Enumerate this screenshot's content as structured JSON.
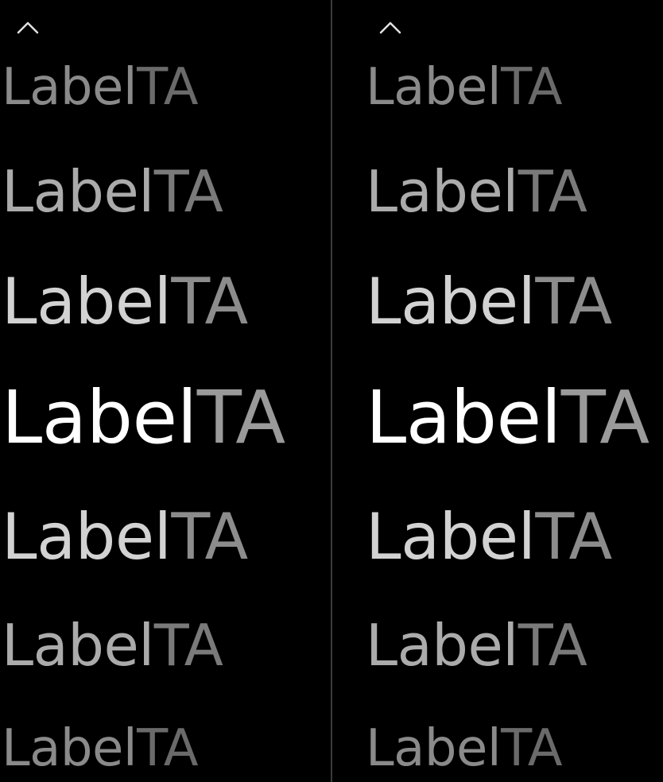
{
  "picker_left": {
    "scroll_up_icon": "chevron-up-icon",
    "items": [
      {
        "label": "Label",
        "suffix": "TA"
      },
      {
        "label": "Label",
        "suffix": "TA"
      },
      {
        "label": "Label",
        "suffix": "TA"
      },
      {
        "label": "Label",
        "suffix": "TA"
      },
      {
        "label": "Label",
        "suffix": "TA"
      },
      {
        "label": "Label",
        "suffix": "TA"
      },
      {
        "label": "Label",
        "suffix": "TA"
      }
    ]
  },
  "picker_right": {
    "scroll_up_icon": "chevron-up-icon",
    "items": [
      {
        "label": "Label",
        "suffix": "TA"
      },
      {
        "label": "Label",
        "suffix": "TA"
      },
      {
        "label": "Label",
        "suffix": "TA"
      },
      {
        "label": "Label",
        "suffix": "TA"
      },
      {
        "label": "Label",
        "suffix": "TA"
      },
      {
        "label": "Label",
        "suffix": "TA"
      },
      {
        "label": "Label",
        "suffix": "TA"
      }
    ]
  },
  "colors": {
    "background": "#000000",
    "selected": "#ffffff",
    "divider": "#3a3a3a"
  }
}
